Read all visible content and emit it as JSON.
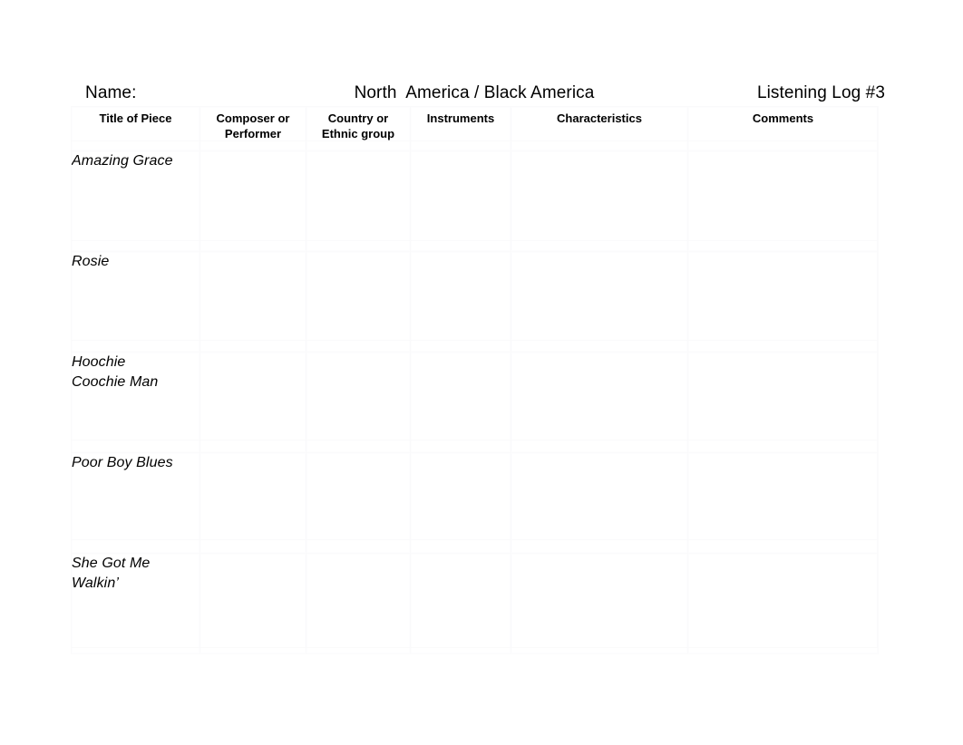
{
  "document": {
    "name_label": "Name:",
    "unit_title": "North  America / Black America",
    "log_title": "Listening Log #3"
  },
  "table": {
    "columns": [
      {
        "key": "title",
        "label": "Title of Piece"
      },
      {
        "key": "composer",
        "label": "Composer or Performer"
      },
      {
        "key": "country",
        "label": "Country or Ethnic group"
      },
      {
        "key": "instruments",
        "label": "Instruments"
      },
      {
        "key": "characteristics",
        "label": "Characteristics"
      },
      {
        "key": "comments",
        "label": "Comments"
      }
    ],
    "rows": [
      {
        "title": "Amazing Grace",
        "composer": "",
        "country": "",
        "instruments": "",
        "characteristics": "",
        "comments": ""
      },
      {
        "title": "Rosie",
        "composer": "",
        "country": "",
        "instruments": "",
        "characteristics": "",
        "comments": ""
      },
      {
        "title": "Hoochie\nCoochie Man",
        "composer": "",
        "country": "",
        "instruments": "",
        "characteristics": "",
        "comments": ""
      },
      {
        "title": "Poor Boy Blues",
        "composer": "",
        "country": "",
        "instruments": "",
        "characteristics": "",
        "comments": ""
      },
      {
        "title": "She Got Me\nWalkin’",
        "composer": "",
        "country": "",
        "instruments": "",
        "characteristics": "",
        "comments": ""
      }
    ]
  },
  "style": {
    "page_background": "#ffffff",
    "text_color": "#000000",
    "grid_line_color": "#fafafb"
  }
}
